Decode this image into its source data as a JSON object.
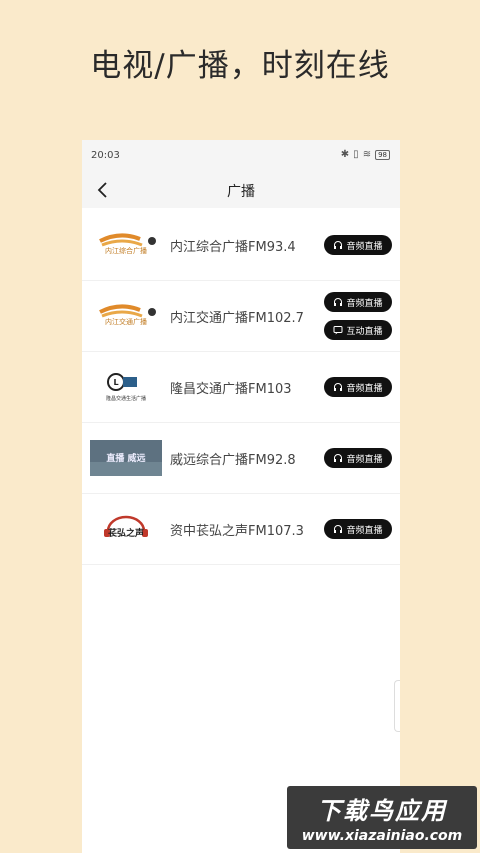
{
  "headline": "电视/广播，时刻在线",
  "status": {
    "time": "20:03",
    "battery": "98"
  },
  "nav": {
    "title": "广播"
  },
  "stations": [
    {
      "name": "内江综合广播FM93.4",
      "logo_text": "内江综合广播",
      "buttons": [
        {
          "label": "音频直播",
          "icon": "headphones-icon"
        }
      ]
    },
    {
      "name": "内江交通广播FM102.7",
      "logo_text": "内江交通广播",
      "buttons": [
        {
          "label": "音频直播",
          "icon": "headphones-icon"
        },
        {
          "label": "互动直播",
          "icon": "chat-icon"
        }
      ]
    },
    {
      "name": "隆昌交通广播FM103",
      "logo_text": "隆昌交通生活广播",
      "buttons": [
        {
          "label": "音频直播",
          "icon": "headphones-icon"
        }
      ]
    },
    {
      "name": "威远综合广播FM92.8",
      "logo_text": "直播 威远",
      "buttons": [
        {
          "label": "音频直播",
          "icon": "headphones-icon"
        }
      ]
    },
    {
      "name": "资中苌弘之声FM107.3",
      "logo_text": "苌弘之声",
      "buttons": [
        {
          "label": "音频直播",
          "icon": "headphones-icon"
        }
      ]
    }
  ],
  "watermark": {
    "main": "下载鸟应用",
    "url": "www.xiazainiao.com"
  },
  "colors": {
    "background": "#faeacb",
    "pill": "#111111"
  }
}
